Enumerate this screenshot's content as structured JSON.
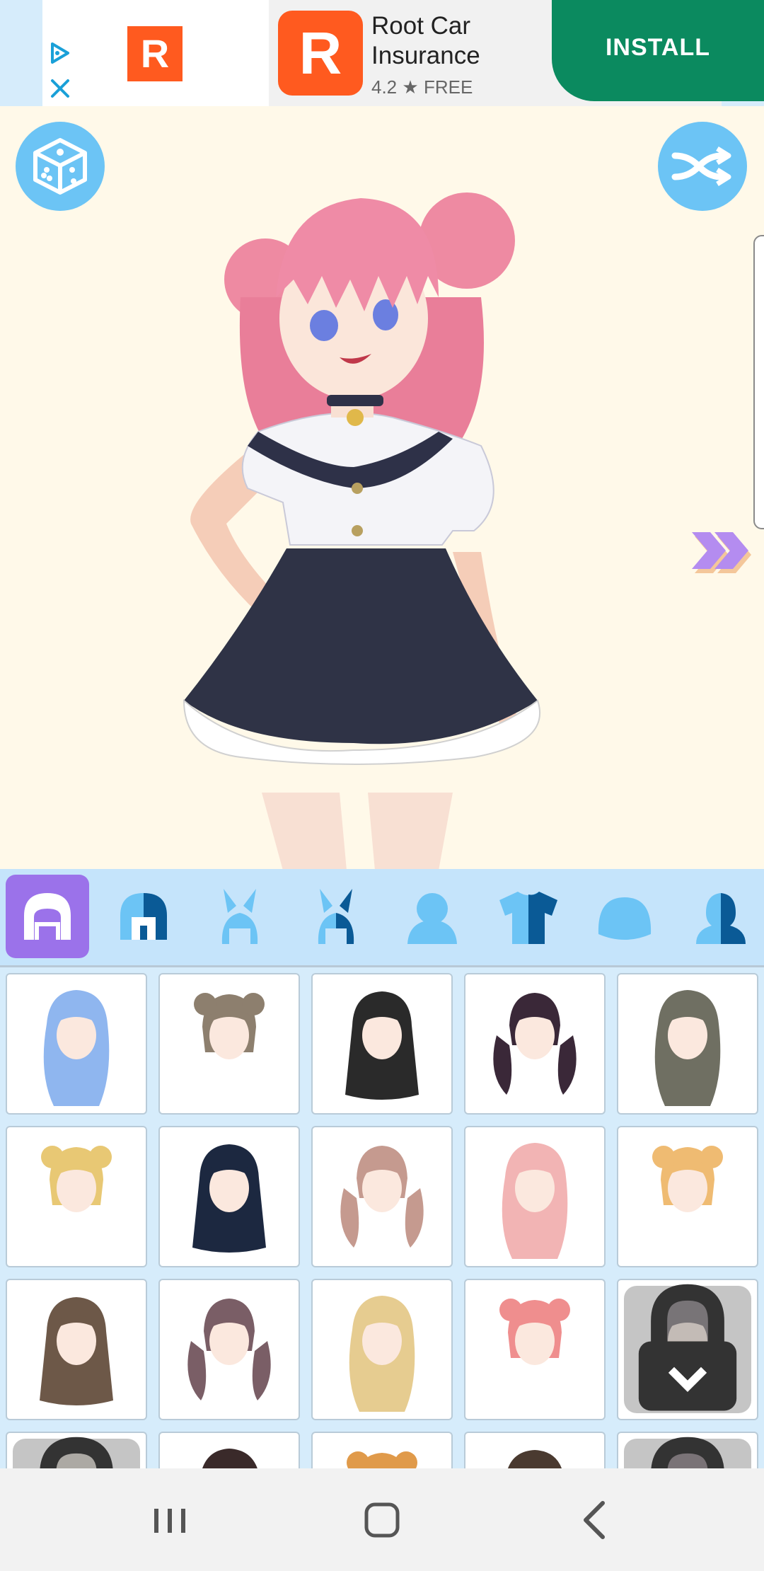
{
  "ad": {
    "small_logo_letter": "R",
    "big_logo_letter": "R",
    "title": "Root Car Insurance",
    "rating": "4.2",
    "rating_star": "★",
    "price": "FREE",
    "install_label": "INSTALL",
    "brand_color": "#ff5a1f",
    "install_color": "#0b8a5f"
  },
  "stage": {
    "background": "#fff9e9",
    "buttons": {
      "random": "dice-icon",
      "shuffle": "shuffle-icon",
      "next": "double-chevron-right-icon"
    }
  },
  "tabs": [
    {
      "name": "hair-front",
      "icon": "hair-front-icon",
      "active": true
    },
    {
      "name": "hair-back",
      "icon": "hair-back-icon",
      "active": false
    },
    {
      "name": "bunny-ears",
      "icon": "bunny-ears-icon",
      "active": false
    },
    {
      "name": "bunny-ears-alt",
      "icon": "bunny-ears-alt-icon",
      "active": false
    },
    {
      "name": "body",
      "icon": "body-icon",
      "active": false
    },
    {
      "name": "top",
      "icon": "shirt-icon",
      "active": false
    },
    {
      "name": "head",
      "icon": "head-icon",
      "active": false
    },
    {
      "name": "half-body",
      "icon": "half-body-icon",
      "active": false
    }
  ],
  "grid": {
    "items": [
      {
        "color": "#8fb6ef",
        "locked": false
      },
      {
        "color": "#8d7f6e",
        "locked": false
      },
      {
        "color": "#2a2a2a",
        "locked": false
      },
      {
        "color": "#3a2838",
        "locked": false
      },
      {
        "color": "#6f6f62",
        "locked": false
      },
      {
        "color": "#e8c874",
        "locked": false
      },
      {
        "color": "#1c2840",
        "locked": false
      },
      {
        "color": "#c59a8f",
        "locked": false
      },
      {
        "color": "#f2b4b4",
        "locked": false
      },
      {
        "color": "#efbb72",
        "locked": false
      },
      {
        "color": "#6d5848",
        "locked": false
      },
      {
        "color": "#7a5e66",
        "locked": false
      },
      {
        "color": "#e6cc90",
        "locked": false
      },
      {
        "color": "#ef8e8e",
        "locked": false
      },
      {
        "color": "#544c52",
        "locked": true
      },
      {
        "color": "#c8c0b6",
        "locked": true
      },
      {
        "color": "#3a2a2a",
        "locked": false
      },
      {
        "color": "#e09a4a",
        "locked": false
      },
      {
        "color": "#4a3a30",
        "locked": false
      },
      {
        "color": "#5a4a52",
        "locked": true
      }
    ]
  },
  "navbar": {
    "recents": "recents-icon",
    "home": "home-icon",
    "back": "back-icon"
  }
}
